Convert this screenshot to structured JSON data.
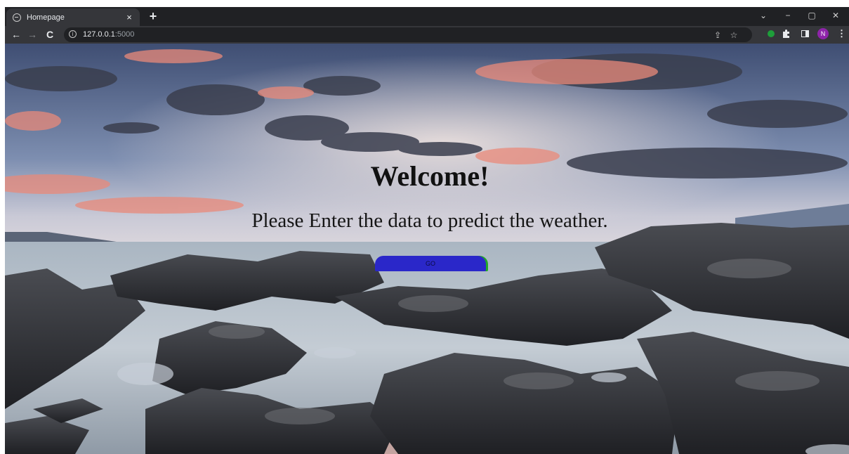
{
  "browser": {
    "tab_title": "Homepage",
    "tab_close": "×",
    "new_tab": "+",
    "window_controls": {
      "minimize": "−",
      "restore": "▢",
      "close": "✕",
      "tab_search": "⌄"
    },
    "nav": {
      "back": "←",
      "forward": "→",
      "reload": "C"
    },
    "address": {
      "host": "127.0.0.1",
      "port": ":5000"
    },
    "profile_initial": "N",
    "menu": "⋮"
  },
  "page": {
    "heading": "Welcome!",
    "subtitle": "Please Enter the data to predict the weather.",
    "go_button": "GO"
  },
  "colors": {
    "button": "#2a27c9",
    "button_edge": "#21a826",
    "avatar": "#8e24aa",
    "extension": "#1e9e3a"
  }
}
